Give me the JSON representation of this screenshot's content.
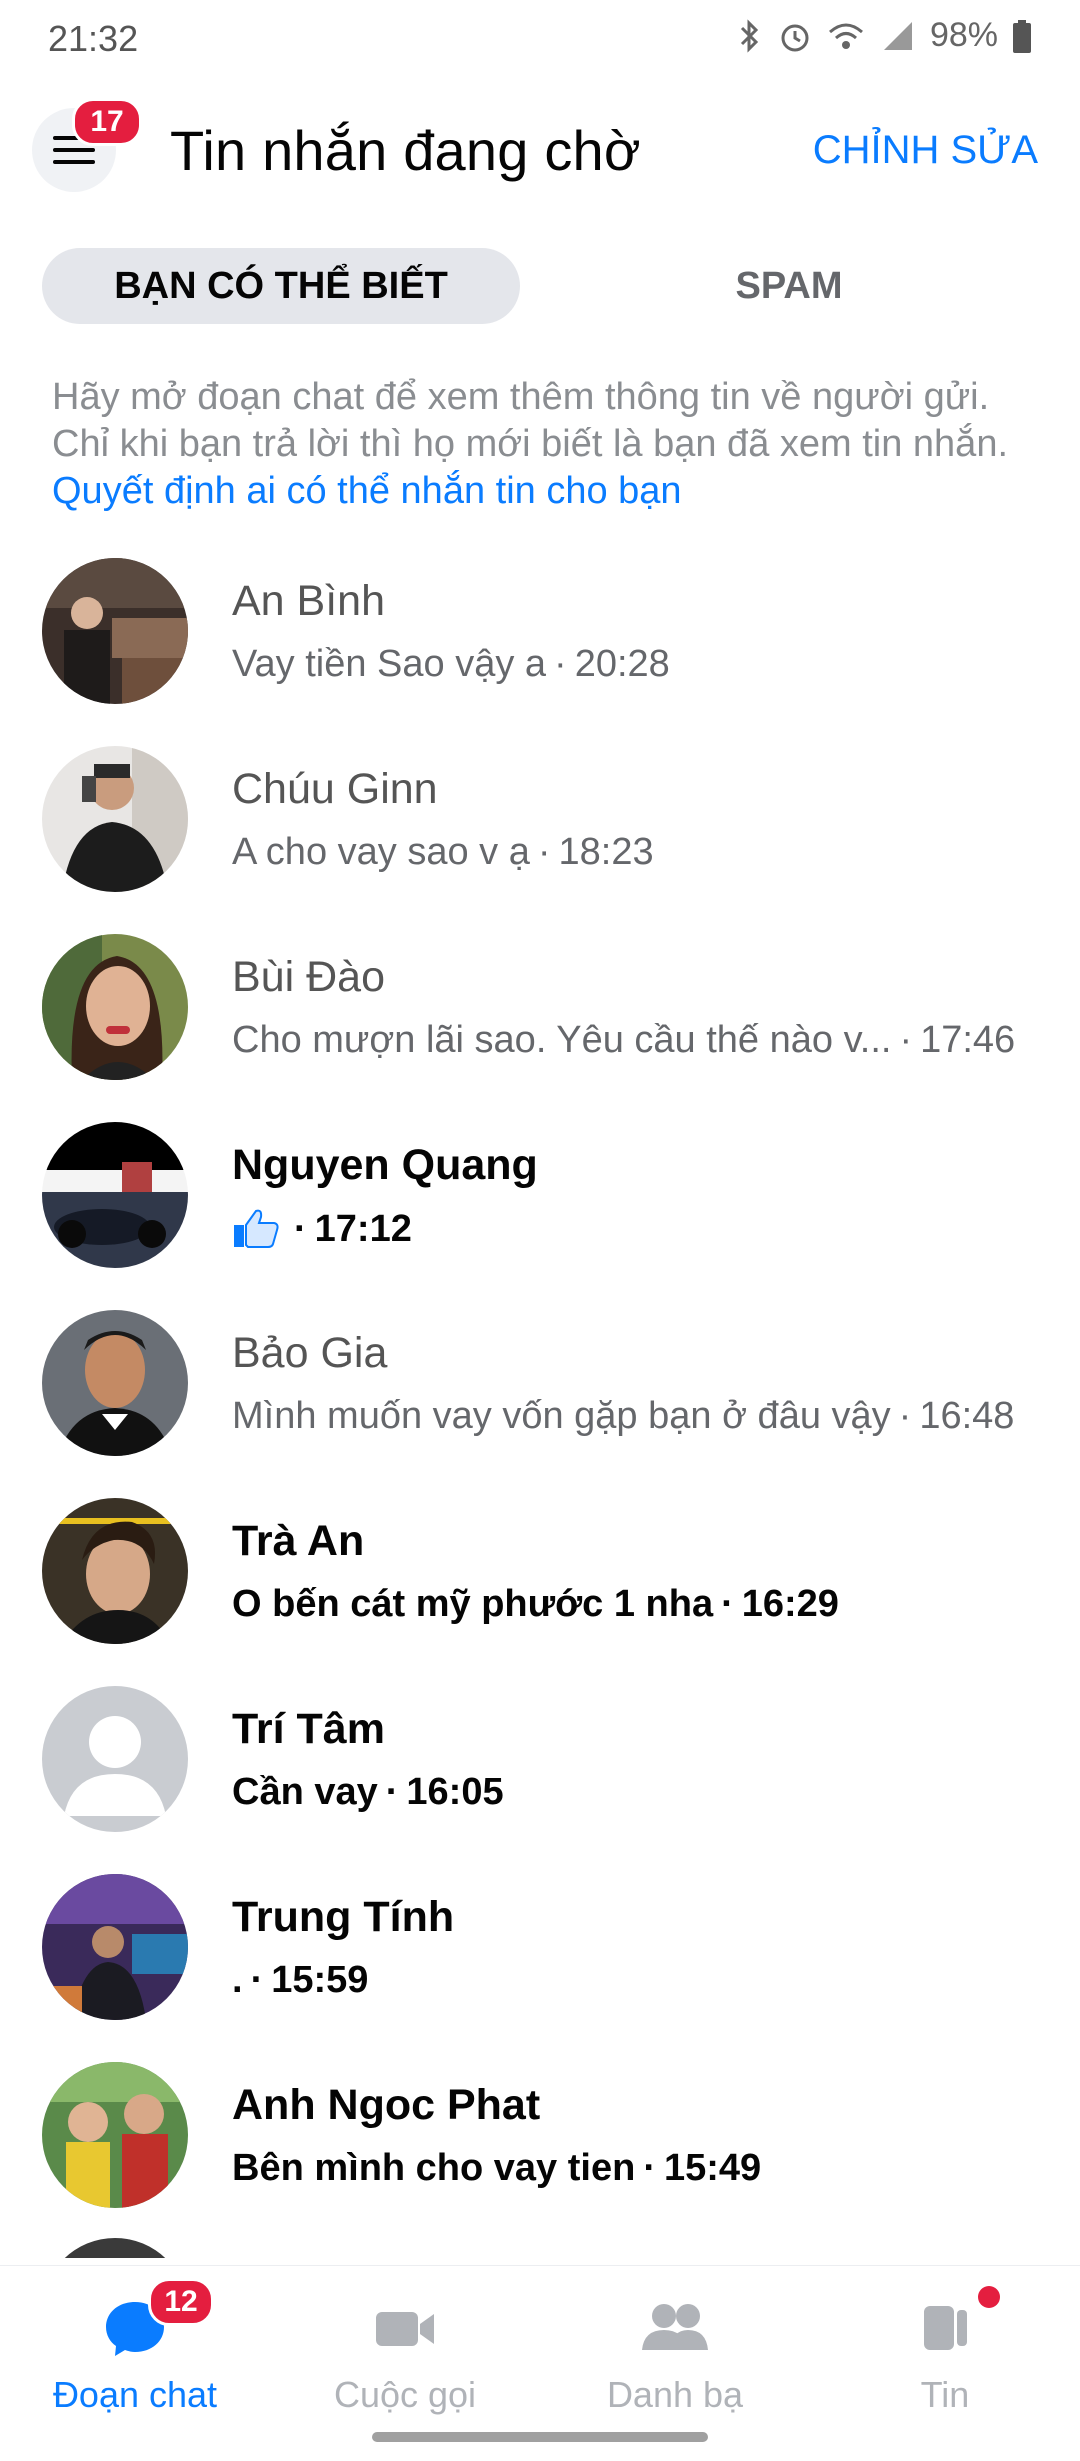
{
  "status_bar": {
    "time": "21:32",
    "battery": "98%"
  },
  "header": {
    "menu_badge": "17",
    "title": "Tin nhắn đang chờ",
    "edit_label": "CHỈNH SỬA"
  },
  "tabs": {
    "active": "BẠN CÓ THỂ BIẾT",
    "spam": "SPAM"
  },
  "info": {
    "text": "Hãy mở đoạn chat để xem thêm thông tin về người gửi. Chỉ khi bạn trả lời thì họ mới biết là bạn đã xem tin nhắn.",
    "link": "Quyết định ai có thể nhắn tin cho bạn"
  },
  "conversations": [
    {
      "name": "An Bình",
      "preview": "Vay tiền Sao vậy a",
      "time": "20:28",
      "unread": false
    },
    {
      "name": "Chúu Ginn",
      "preview": "A cho vay sao v ạ",
      "time": "18:23",
      "unread": false
    },
    {
      "name": "Bùi Đào",
      "preview": "Cho mượn lãi sao. Yêu cầu thế nào v...",
      "time": "17:46",
      "unread": false
    },
    {
      "name": "Nguyen Quang",
      "preview": "",
      "time": "17:12",
      "unread": true,
      "like_icon": "thumbs-up-icon"
    },
    {
      "name": "Bảo Gia",
      "preview": "Mình muốn vay vốn gặp bạn ở đâu vậy",
      "time": "16:48",
      "unread": false
    },
    {
      "name": "Trà An",
      "preview": "O bến cát mỹ phước 1 nha",
      "time": "16:29",
      "unread": true
    },
    {
      "name": "Trí Tâm",
      "preview": "Cần vay",
      "time": "16:05",
      "unread": true
    },
    {
      "name": "Trung Tính",
      "preview": ".",
      "time": "15:59",
      "unread": true
    },
    {
      "name": "Anh Ngoc Phat",
      "preview": "Bên mình cho vay tien",
      "time": "15:49",
      "unread": true
    }
  ],
  "separator": "·",
  "bottom_nav": {
    "chats": {
      "label": "Đoạn chat",
      "badge": "12",
      "icon": "chat-bubble-icon"
    },
    "calls": {
      "label": "Cuộc gọi",
      "icon": "video-camera-icon"
    },
    "people": {
      "label": "Danh bạ",
      "icon": "people-icon"
    },
    "stories": {
      "label": "Tin",
      "icon": "stories-icon"
    }
  },
  "colors": {
    "accent": "#0a7cff",
    "badge": "#e41e3f",
    "muted": "#65676b"
  }
}
